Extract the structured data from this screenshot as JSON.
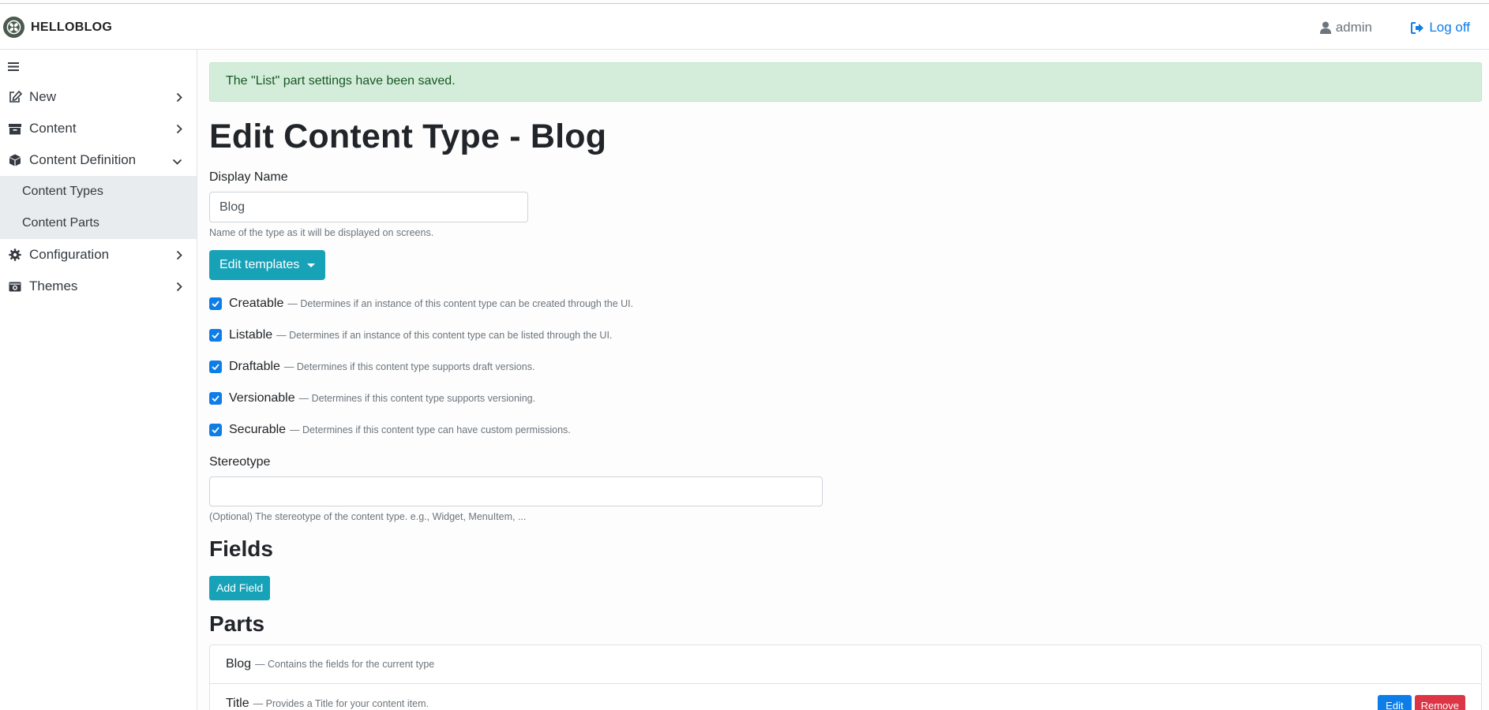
{
  "navbar": {
    "brand": "HELLOBLOG",
    "user_name": "admin",
    "logoff_label": "Log off"
  },
  "sidebar": {
    "items": [
      {
        "label": "New",
        "icon": "edit-icon"
      },
      {
        "label": "Content",
        "icon": "archive-icon"
      },
      {
        "label": "Content Definition",
        "icon": "cube-icon",
        "expanded": true
      },
      {
        "label": "Configuration",
        "icon": "gear-icon"
      },
      {
        "label": "Themes",
        "icon": "camera-retro-icon"
      }
    ],
    "submenu": [
      {
        "label": "Content Types"
      },
      {
        "label": "Content Parts"
      }
    ]
  },
  "alert": {
    "message": "The \"List\" part settings have been saved."
  },
  "page": {
    "title": "Edit Content Type - Blog",
    "display_name_label": "Display Name",
    "display_name_value": "Blog",
    "display_name_hint": "Name of the type as it will be displayed on screens.",
    "edit_templates_label": "Edit templates",
    "stereotype_label": "Stereotype",
    "stereotype_value": "",
    "stereotype_hint": "(Optional) The stereotype of the content type. e.g., Widget, MenuItem, ..."
  },
  "options": [
    {
      "label": "Creatable",
      "desc": "— Determines if an instance of this content type can be created through the UI.",
      "checked": true
    },
    {
      "label": "Listable",
      "desc": "— Determines if an instance of this content type can be listed through the UI.",
      "checked": true
    },
    {
      "label": "Draftable",
      "desc": "— Determines if this content type supports draft versions.",
      "checked": true
    },
    {
      "label": "Versionable",
      "desc": "— Determines if this content type supports versioning.",
      "checked": true
    },
    {
      "label": "Securable",
      "desc": "— Determines if this content type can have custom permissions.",
      "checked": true
    }
  ],
  "fields": {
    "heading": "Fields",
    "add_label": "Add Field"
  },
  "parts": {
    "heading": "Parts",
    "items": [
      {
        "name": "Blog",
        "desc": "— Contains the fields for the current type"
      },
      {
        "name": "Title",
        "desc": "— Provides a Title for your content item."
      }
    ],
    "edit_label": "Edit",
    "remove_label": "Remove"
  },
  "colors": {
    "accent": "#17a2b8",
    "primary": "#0d7de8",
    "danger": "#dc3545",
    "success_bg": "#d4edda"
  }
}
